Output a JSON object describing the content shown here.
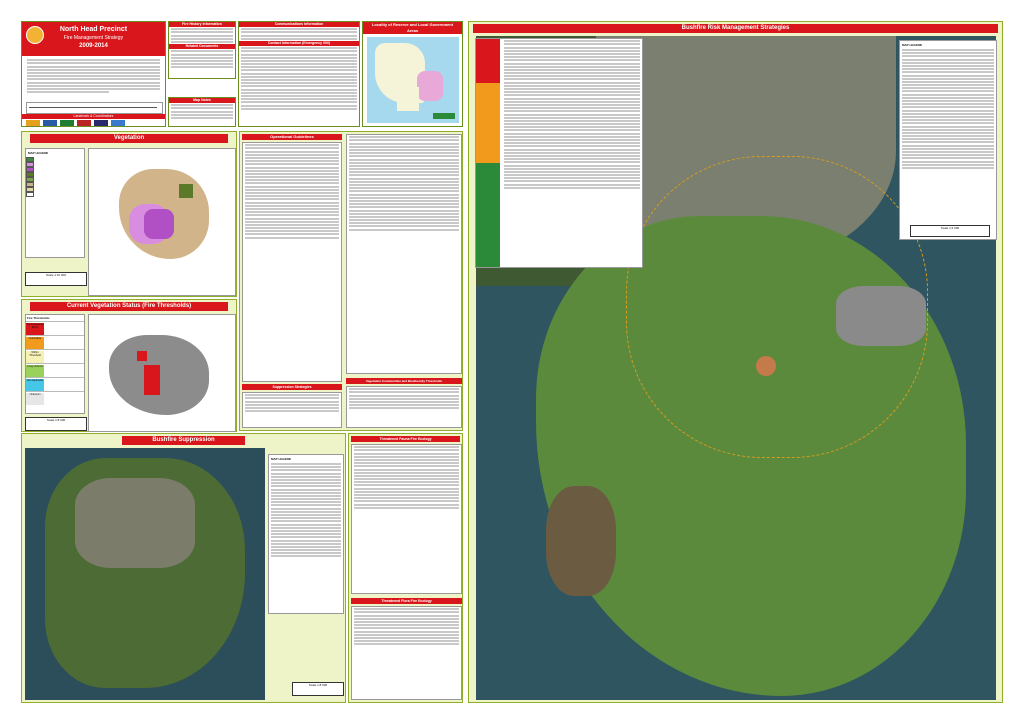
{
  "header": {
    "title": "North Head Precinct",
    "subtitle": "Fire Management Strategy",
    "years": "2009-2014",
    "landmark": "Landmark & Coordinators"
  },
  "sections": {
    "vegetation": "Vegetation",
    "operational": "Operational Guidelines",
    "fire_thresholds_status": "Current Vegetation Status (Fire Thresholds)",
    "fire_thresholds": "Fire Thresholds",
    "suppression_strategies": "Suppression Strategies",
    "bushfire_suppression": "Bushfire Suppression",
    "veg_communities": "Vegetation Communities and Biodiversity Thresholds",
    "threatened_fauna": "Threatened Fauna Fire Ecology",
    "threatened_flora": "Threatened Flora Fire Ecology",
    "communications": "Communications Information",
    "contact": "Contact Information (Emergency 000)",
    "related_docs": "Related Documents",
    "map_notes": "Map Notes",
    "fire_history": "Fire History Information",
    "locality": "Locality of Reserve and Local Government Areas",
    "risk": "Bushfire Risk Management Strategies"
  },
  "threshold_labels": [
    "Too Frequently Burnt",
    "Vulnerable",
    "Within Threshold",
    "Long Unburnt",
    "Not Applicable",
    "Unknown"
  ],
  "threshold_colors": [
    "#d8161b",
    "#f29a1c",
    "#f5f0b4",
    "#9ad15c",
    "#46c7e8",
    "#e6e6e6"
  ],
  "legends": {
    "map_legend": "MAP LEGEND",
    "scale_a": "Scale 1:10 000",
    "scale_b": "Scale 1:8 000",
    "scale_c": "Scale 1:8 000",
    "scale_d": "Scale 1:6 000"
  },
  "right_legend_title": "MAP LEGEND",
  "icons": {
    "north": "north-arrow-icon",
    "flame": "flame-logo-icon"
  }
}
